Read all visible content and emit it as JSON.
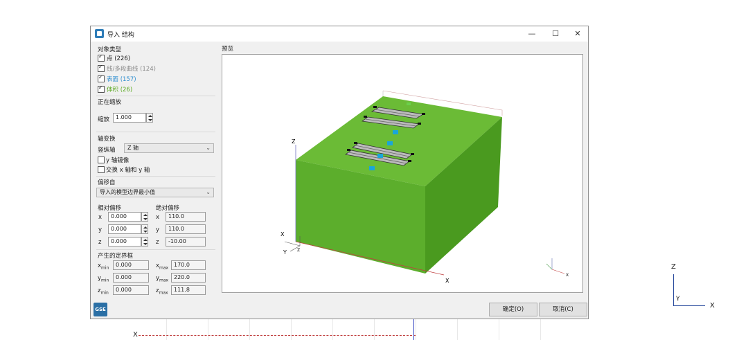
{
  "background": {
    "x_label": "X",
    "gizmo": {
      "z": "Z",
      "y": "Y",
      "x": "X"
    }
  },
  "dialog": {
    "title": "导入 结构",
    "window_controls": {
      "minimize": "—",
      "maximize": "☐",
      "close": "✕"
    },
    "object_types": {
      "title": "对象类型",
      "items": [
        {
          "label": "点 (226)",
          "checked": true,
          "color": "#1a1a1a"
        },
        {
          "label": "线/多段曲线 (124)",
          "checked": true,
          "color": "#8a8a8a"
        },
        {
          "label": "表面 (157)",
          "checked": true,
          "color": "#2f8fd0"
        },
        {
          "label": "体积 (26)",
          "checked": true,
          "color": "#5aa820"
        }
      ]
    },
    "scaling": {
      "title": "正在缩放",
      "scale_label": "缩放",
      "scale_value": "1.000"
    },
    "axis_transform": {
      "title": "轴变换",
      "vertical_axis_label": "竖纵轴",
      "vertical_axis_value": "Z 轴",
      "mirror_y_label": "y 轴镜像",
      "swap_xy_label": "交换 x 轴和 y 轴"
    },
    "offset": {
      "title": "偏移自",
      "source_value": "导入的模型边界最小值",
      "relative_title": "相对偏移",
      "absolute_title": "绝对偏移",
      "rows": [
        {
          "axis": "x",
          "relative": "0.000",
          "absolute": "110.0"
        },
        {
          "axis": "y",
          "relative": "0.000",
          "absolute": "110.0"
        },
        {
          "axis": "z",
          "relative": "0.000",
          "absolute": "-10.00"
        }
      ]
    },
    "bounding_box": {
      "title": "产生的定界框",
      "rows": [
        {
          "min_label": "x",
          "min_sub": "min",
          "min_value": "0.000",
          "max_label": "x",
          "max_sub": "max",
          "max_value": "170.0"
        },
        {
          "min_label": "y",
          "min_sub": "min",
          "min_value": "0.000",
          "max_label": "y",
          "max_sub": "max",
          "max_value": "220.0"
        },
        {
          "min_label": "z",
          "min_sub": "min",
          "min_value": "0.000",
          "max_label": "z",
          "max_sub": "max",
          "max_value": "111.8"
        }
      ]
    },
    "preview": {
      "title": "预览",
      "axis_labels": {
        "z": "Z",
        "x": "X",
        "origin_x": "X",
        "origin_y": "Y",
        "origin_z": "Z",
        "box_x": "X"
      },
      "colors": {
        "box_front": "#5cae2c",
        "box_side": "#4a9a1f",
        "box_top": "#6bbb36",
        "marker": "#1aa6d9"
      }
    },
    "buttons": {
      "ok": "确定(O)",
      "cancel": "取消(C)"
    },
    "logo_text": "GSE"
  }
}
